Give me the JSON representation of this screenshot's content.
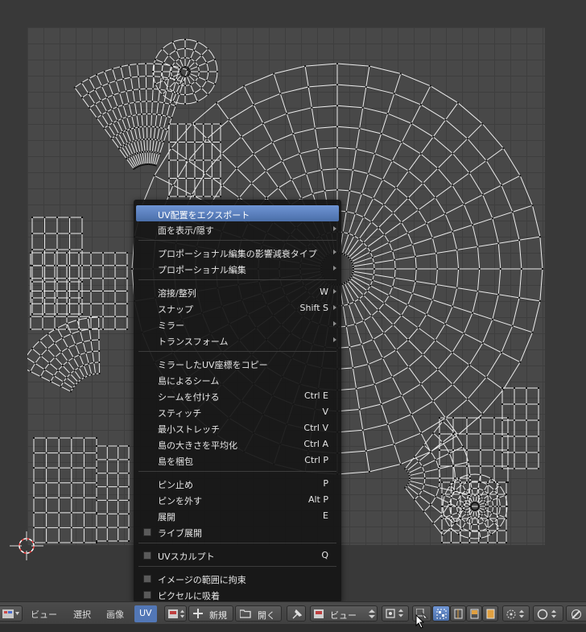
{
  "menu": {
    "items": [
      {
        "id": "export-uv-layout",
        "label": "UV配置をエクスポート",
        "shortcut": "",
        "submenu": false,
        "checkbox": false,
        "highlighted": true
      },
      {
        "id": "show-hide-faces",
        "label": "面を表示/隠す",
        "shortcut": "",
        "submenu": true,
        "checkbox": false
      },
      {
        "id": "proportional-falloff",
        "label": "プロポーショナル編集の影響減衰タイプ",
        "shortcut": "",
        "submenu": true,
        "checkbox": false
      },
      {
        "id": "proportional-editing",
        "label": "プロポーショナル編集",
        "shortcut": "",
        "submenu": true,
        "checkbox": false
      },
      {
        "id": "weld-align",
        "label": "溶接/整列",
        "shortcut": "W",
        "submenu": true,
        "checkbox": false
      },
      {
        "id": "snap",
        "label": "スナップ",
        "shortcut": "Shift S",
        "submenu": true,
        "checkbox": false
      },
      {
        "id": "mirror",
        "label": "ミラー",
        "shortcut": "",
        "submenu": true,
        "checkbox": false
      },
      {
        "id": "transform",
        "label": "トランスフォーム",
        "shortcut": "",
        "submenu": true,
        "checkbox": false
      },
      {
        "id": "copy-mirrored-uv",
        "label": "ミラーしたUV座標をコピー",
        "shortcut": "",
        "submenu": false,
        "checkbox": false
      },
      {
        "id": "seams-from-islands",
        "label": "島によるシーム",
        "shortcut": "",
        "submenu": false,
        "checkbox": false
      },
      {
        "id": "mark-seam",
        "label": "シームを付ける",
        "shortcut": "Ctrl E",
        "submenu": false,
        "checkbox": false
      },
      {
        "id": "stitch",
        "label": "スティッチ",
        "shortcut": "V",
        "submenu": false,
        "checkbox": false
      },
      {
        "id": "minimize-stretch",
        "label": "最小ストレッチ",
        "shortcut": "Ctrl V",
        "submenu": false,
        "checkbox": false
      },
      {
        "id": "average-islands-scale",
        "label": "島の大きさを平均化",
        "shortcut": "Ctrl A",
        "submenu": false,
        "checkbox": false
      },
      {
        "id": "pack-islands",
        "label": "島を梱包",
        "shortcut": "Ctrl P",
        "submenu": false,
        "checkbox": false
      },
      {
        "id": "pin",
        "label": "ピン止め",
        "shortcut": "P",
        "submenu": false,
        "checkbox": false
      },
      {
        "id": "unpin",
        "label": "ピンを外す",
        "shortcut": "Alt P",
        "submenu": false,
        "checkbox": false
      },
      {
        "id": "unwrap",
        "label": "展開",
        "shortcut": "E",
        "submenu": false,
        "checkbox": false
      },
      {
        "id": "live-unwrap",
        "label": "ライブ展開",
        "shortcut": "",
        "submenu": false,
        "checkbox": true
      },
      {
        "id": "uv-sculpt",
        "label": "UVスカルプト",
        "shortcut": "Q",
        "submenu": false,
        "checkbox": true
      },
      {
        "id": "constrain-to-image",
        "label": "イメージの範囲に拘束",
        "shortcut": "",
        "submenu": false,
        "checkbox": true
      },
      {
        "id": "snap-to-pixels",
        "label": "ピクセルに吸着",
        "shortcut": "",
        "submenu": false,
        "checkbox": true
      }
    ]
  },
  "header": {
    "menus": {
      "view": "ビュー",
      "select": "選択",
      "image": "画像",
      "uv": "UV"
    },
    "new_label": "新規",
    "open_label": "開く",
    "view_dropdown": "ビュー"
  },
  "colors": {
    "accent": "#5277b6",
    "menu_highlight": "#6f95d4",
    "canvas": "#484848",
    "grid": "#3e3e3e"
  },
  "icons": [
    "editor-type-icon",
    "image-browse-icon",
    "plus-icon",
    "folder-icon",
    "pin-icon",
    "image-icon",
    "pivot-icon",
    "sticky-select-icon",
    "vertex-select-icon",
    "edge-select-icon",
    "face-select-icon",
    "island-select-icon",
    "proportional-icon",
    "falloff-icon",
    "snap-icon",
    "cursor-icon"
  ]
}
